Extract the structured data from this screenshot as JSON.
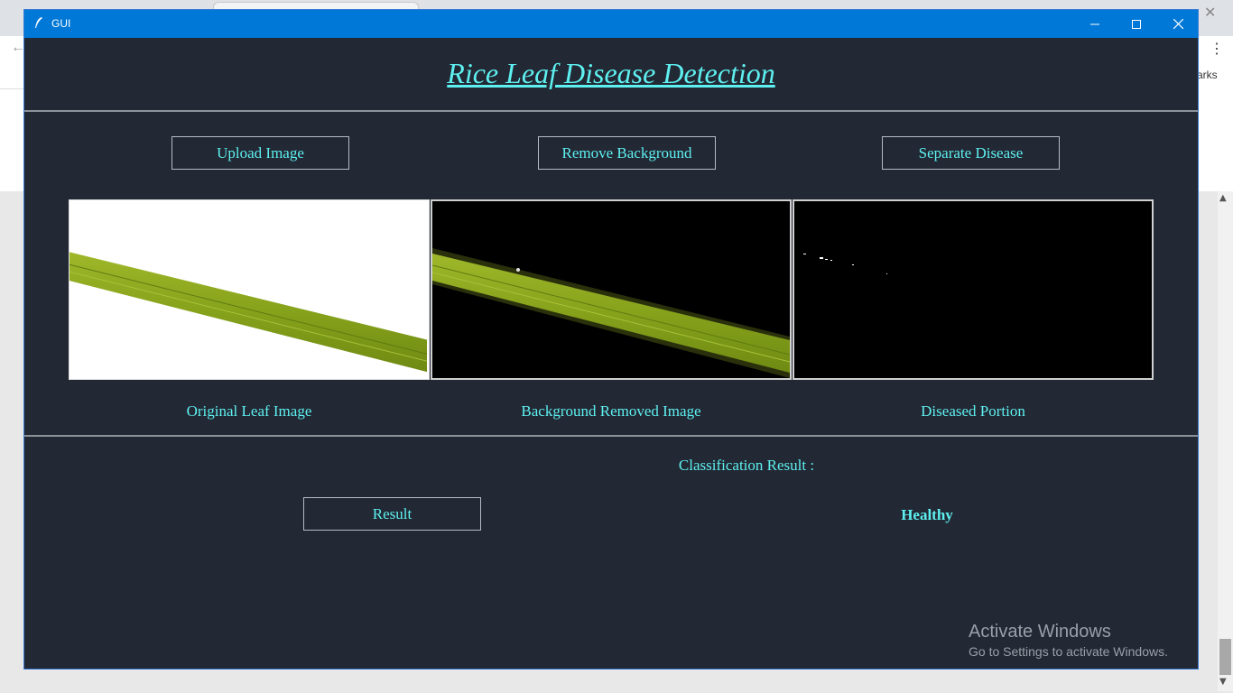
{
  "window": {
    "title": "GUI"
  },
  "browser": {
    "bookmarks_fragment": "arks"
  },
  "app": {
    "heading": "Rice Leaf Disease Detection",
    "buttons": {
      "upload": "Upload Image",
      "remove_background": "Remove Background",
      "separate_disease": "Separate Disease",
      "result": "Result"
    },
    "captions": {
      "original": "Original Leaf Image",
      "background_removed": "Background Removed Image",
      "diseased": "Diseased Portion"
    },
    "classification_label": "Classification Result :",
    "classification_value": "Healthy"
  },
  "watermark": {
    "line1": "Activate Windows",
    "line2": "Go to Settings to activate Windows."
  },
  "colors": {
    "accent_text": "#5ef0f0",
    "window_bg": "#222834",
    "titlebar": "#0078d7",
    "leaf": "#8fae1f"
  }
}
